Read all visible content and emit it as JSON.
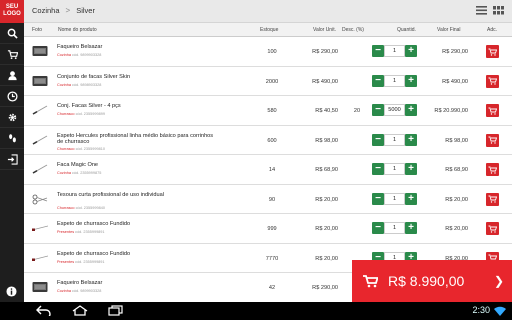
{
  "logo": "SEU LOGO",
  "breadcrumb": {
    "root": "Cozinha",
    "sep": ">",
    "current": "Silver"
  },
  "columns": {
    "photo": "Foto",
    "name": "Nome do produto",
    "stock": "Estoque",
    "unit": "Valor Unit.",
    "disc": "Desc. (%)",
    "qty": "Quantid.",
    "final": "Valor Final",
    "add": "Adc."
  },
  "rows": [
    {
      "name": "Faqueiro Belsazar",
      "cat": "Cozinha",
      "code": "cód. 9899903328",
      "stock": "100",
      "unit": "R$ 290,00",
      "disc": "",
      "qty": "1",
      "final": "R$ 290,00",
      "pic": "box"
    },
    {
      "name": "Conjunto de facas Silver Skin",
      "cat": "Cozinha",
      "code": "cód. 9898903328",
      "stock": "2000",
      "unit": "R$ 490,00",
      "disc": "",
      "qty": "1",
      "final": "R$ 490,00",
      "pic": "box"
    },
    {
      "name": "Conj. Facas Silver - 4 pçs",
      "cat": "Churrasco",
      "code": "cód. 2355999899",
      "stock": "580",
      "unit": "R$ 40,50",
      "disc": "20",
      "qty": "5000",
      "final": "R$ 20.990,00",
      "pic": "knife"
    },
    {
      "name": "Espeto Hercules profissional linha médio básico para corrinhos de churrasco",
      "cat": "Churrasco",
      "code": "cód. 2355999810",
      "stock": "600",
      "unit": "R$ 98,00",
      "disc": "",
      "qty": "1",
      "final": "R$ 98,00",
      "pic": "knife"
    },
    {
      "name": "Faca Magic One",
      "cat": "Cozinha",
      "code": "cód. 2355999875",
      "stock": "14",
      "unit": "R$ 68,90",
      "disc": "",
      "qty": "1",
      "final": "R$ 68,90",
      "pic": "knife"
    },
    {
      "name": "Tesoura curta profissional de uso individual",
      "cat": "Churrasco",
      "code": "cód. 2355999840",
      "stock": "90",
      "unit": "R$ 20,00",
      "disc": "",
      "qty": "1",
      "final": "R$ 20,00",
      "pic": "scissors"
    },
    {
      "name": "Espeto de churrasco Fundido",
      "cat": "Presentes",
      "code": "cód. 2355999891",
      "stock": "999",
      "unit": "R$ 20,00",
      "disc": "",
      "qty": "1",
      "final": "R$ 20,00",
      "pic": "skewer"
    },
    {
      "name": "Espeto de churrasco Fundido",
      "cat": "Presentes",
      "code": "cód. 2355999891",
      "stock": "7770",
      "unit": "R$ 20,00",
      "disc": "",
      "qty": "1",
      "final": "R$ 20,00",
      "pic": "skewer"
    },
    {
      "name": "Faqueiro Belsazar",
      "cat": "Cozinha",
      "code": "cód. 9899903328",
      "stock": "42",
      "unit": "R$ 290,00",
      "disc": "",
      "qty": "1",
      "final": "",
      "pic": "box"
    }
  ],
  "total": "R$ 8.990,00",
  "time": "2:30",
  "colors": {
    "accent": "#e8262d",
    "green": "#2a8a4a",
    "sidebar": "#1e1e1e"
  },
  "sidebar_icons": [
    "search-icon",
    "cart-icon",
    "user-icon",
    "clock-icon",
    "gear-icon",
    "footprint-icon",
    "logout-icon"
  ]
}
